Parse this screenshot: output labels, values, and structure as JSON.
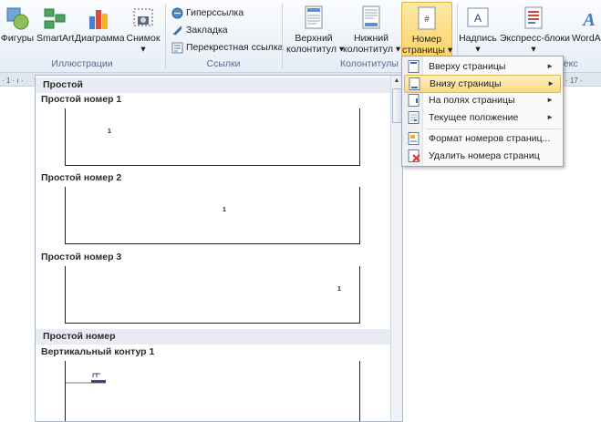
{
  "ribbon": {
    "illustrations": {
      "label": "Иллюстрации",
      "buttons": [
        {
          "label": "Фигуры",
          "icon": "shapes-icon"
        },
        {
          "label": "SmartArt",
          "icon": "smartart-icon"
        },
        {
          "label": "Диаграмма",
          "icon": "chart-icon"
        },
        {
          "label": "Снимок",
          "icon": "screenshot-icon",
          "arrow": "▾"
        }
      ]
    },
    "links": {
      "label": "Ссылки",
      "buttons": [
        {
          "label": "Гиперссылка",
          "icon": "hyperlink-icon"
        },
        {
          "label": "Закладка",
          "icon": "bookmark-icon"
        },
        {
          "label": "Перекрестная ссылка",
          "icon": "cross-reference-icon"
        }
      ]
    },
    "header_footer": {
      "label": "Колонтитулы",
      "header_line1": "Верхний",
      "header_line2": "колонтитул",
      "footer_line1": "Нижний",
      "footer_line2": "колонтитул",
      "page_number_line1": "Номер",
      "page_number_line2": "страницы",
      "arrow": "▾"
    },
    "text": {
      "label": "Текс",
      "textbox": "Надпись",
      "quickparts": "Экспресс-блоки",
      "wordart": "WordArt",
      "arrow": "▾"
    }
  },
  "ruler": {
    "ticks_left": "· 1 · ı ·",
    "ticks_right": "· 17 ·"
  },
  "gallery": {
    "section1_header": "Простой",
    "items": [
      {
        "title": "Простой номер 1",
        "page_number": "1",
        "align": "left"
      },
      {
        "title": "Простой номер 2",
        "page_number": "1",
        "align": "center"
      },
      {
        "title": "Простой номер 3",
        "page_number": "1",
        "align": "right"
      }
    ],
    "section2_header": "Простой номер",
    "item4_title": "Вертикальный контур 1"
  },
  "menu": {
    "items": [
      {
        "label": "Вверху страницы",
        "icon": "page-top-icon",
        "submenu": "►"
      },
      {
        "label": "Внизу страницы",
        "icon": "page-bottom-icon",
        "submenu": "►",
        "highlighted": true
      },
      {
        "label": "На полях страницы",
        "icon": "page-margin-icon",
        "submenu": "►"
      },
      {
        "label": "Текущее положение",
        "icon": "current-position-icon",
        "submenu": "►"
      },
      {
        "label": "Формат номеров страниц...",
        "icon": "format-page-numbers-icon"
      },
      {
        "label": "Удалить номера страниц",
        "icon": "remove-page-numbers-icon"
      }
    ]
  },
  "colors": {
    "highlight": "#fbd97f",
    "accent": "#2b579a",
    "ribbon_bg": "#e6edf7"
  }
}
